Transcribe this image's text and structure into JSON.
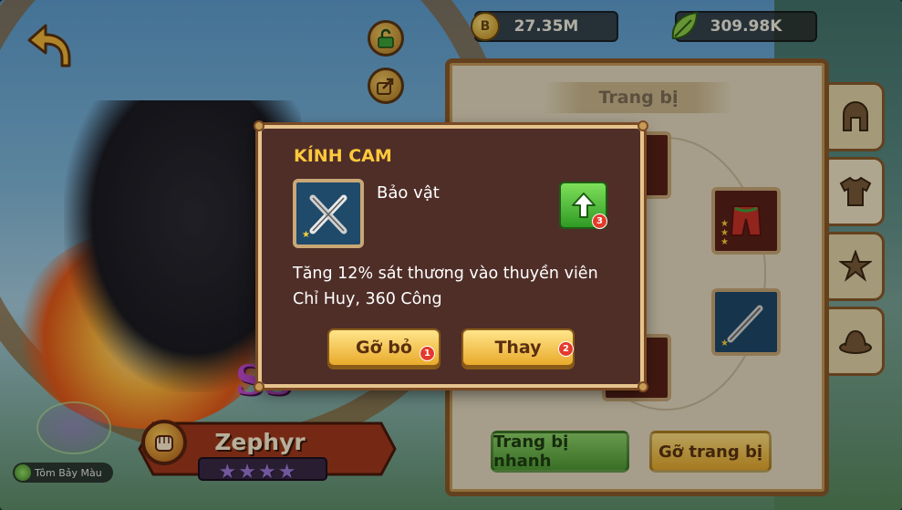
{
  "currencies": {
    "gold": {
      "icon": "coin-icon",
      "value": "27.35M"
    },
    "gems": {
      "icon": "leaf-icon",
      "value": "309.98K"
    }
  },
  "panel": {
    "title": "Trang bị",
    "buttons": {
      "quick_equip": "Trang bị nhanh",
      "unequip_all": "Gỡ trang bị"
    },
    "tabs": [
      {
        "icon": "helmet-icon",
        "active": false
      },
      {
        "icon": "shirt-icon",
        "active": true
      },
      {
        "icon": "star-icon",
        "active": false
      },
      {
        "icon": "hat-icon",
        "active": false
      }
    ]
  },
  "hero": {
    "name": "Zephyr",
    "rank": "SS",
    "stars": "★★★★",
    "class_icon": "fist-icon"
  },
  "pet": {
    "name": "Tôm Bảy Màu"
  },
  "modal": {
    "title": "KÍNH CAM",
    "item_type": "Bảo vật",
    "description_line1": "Tăng 12% sát thương vào thuyền viên",
    "description_line2": "Chỉ Huy, 360 Công",
    "item_stars": "★",
    "upgrade_badge": "3",
    "remove_label": "Gỡ bỏ",
    "remove_badge": "1",
    "replace_label": "Thay",
    "replace_badge": "2"
  },
  "colors": {
    "modal_bg": "#4f2e28",
    "modal_title": "#ffc93c",
    "button_gold": "#f5c84a",
    "button_green": "#6bbd45",
    "badge_red": "#e43a2c"
  }
}
